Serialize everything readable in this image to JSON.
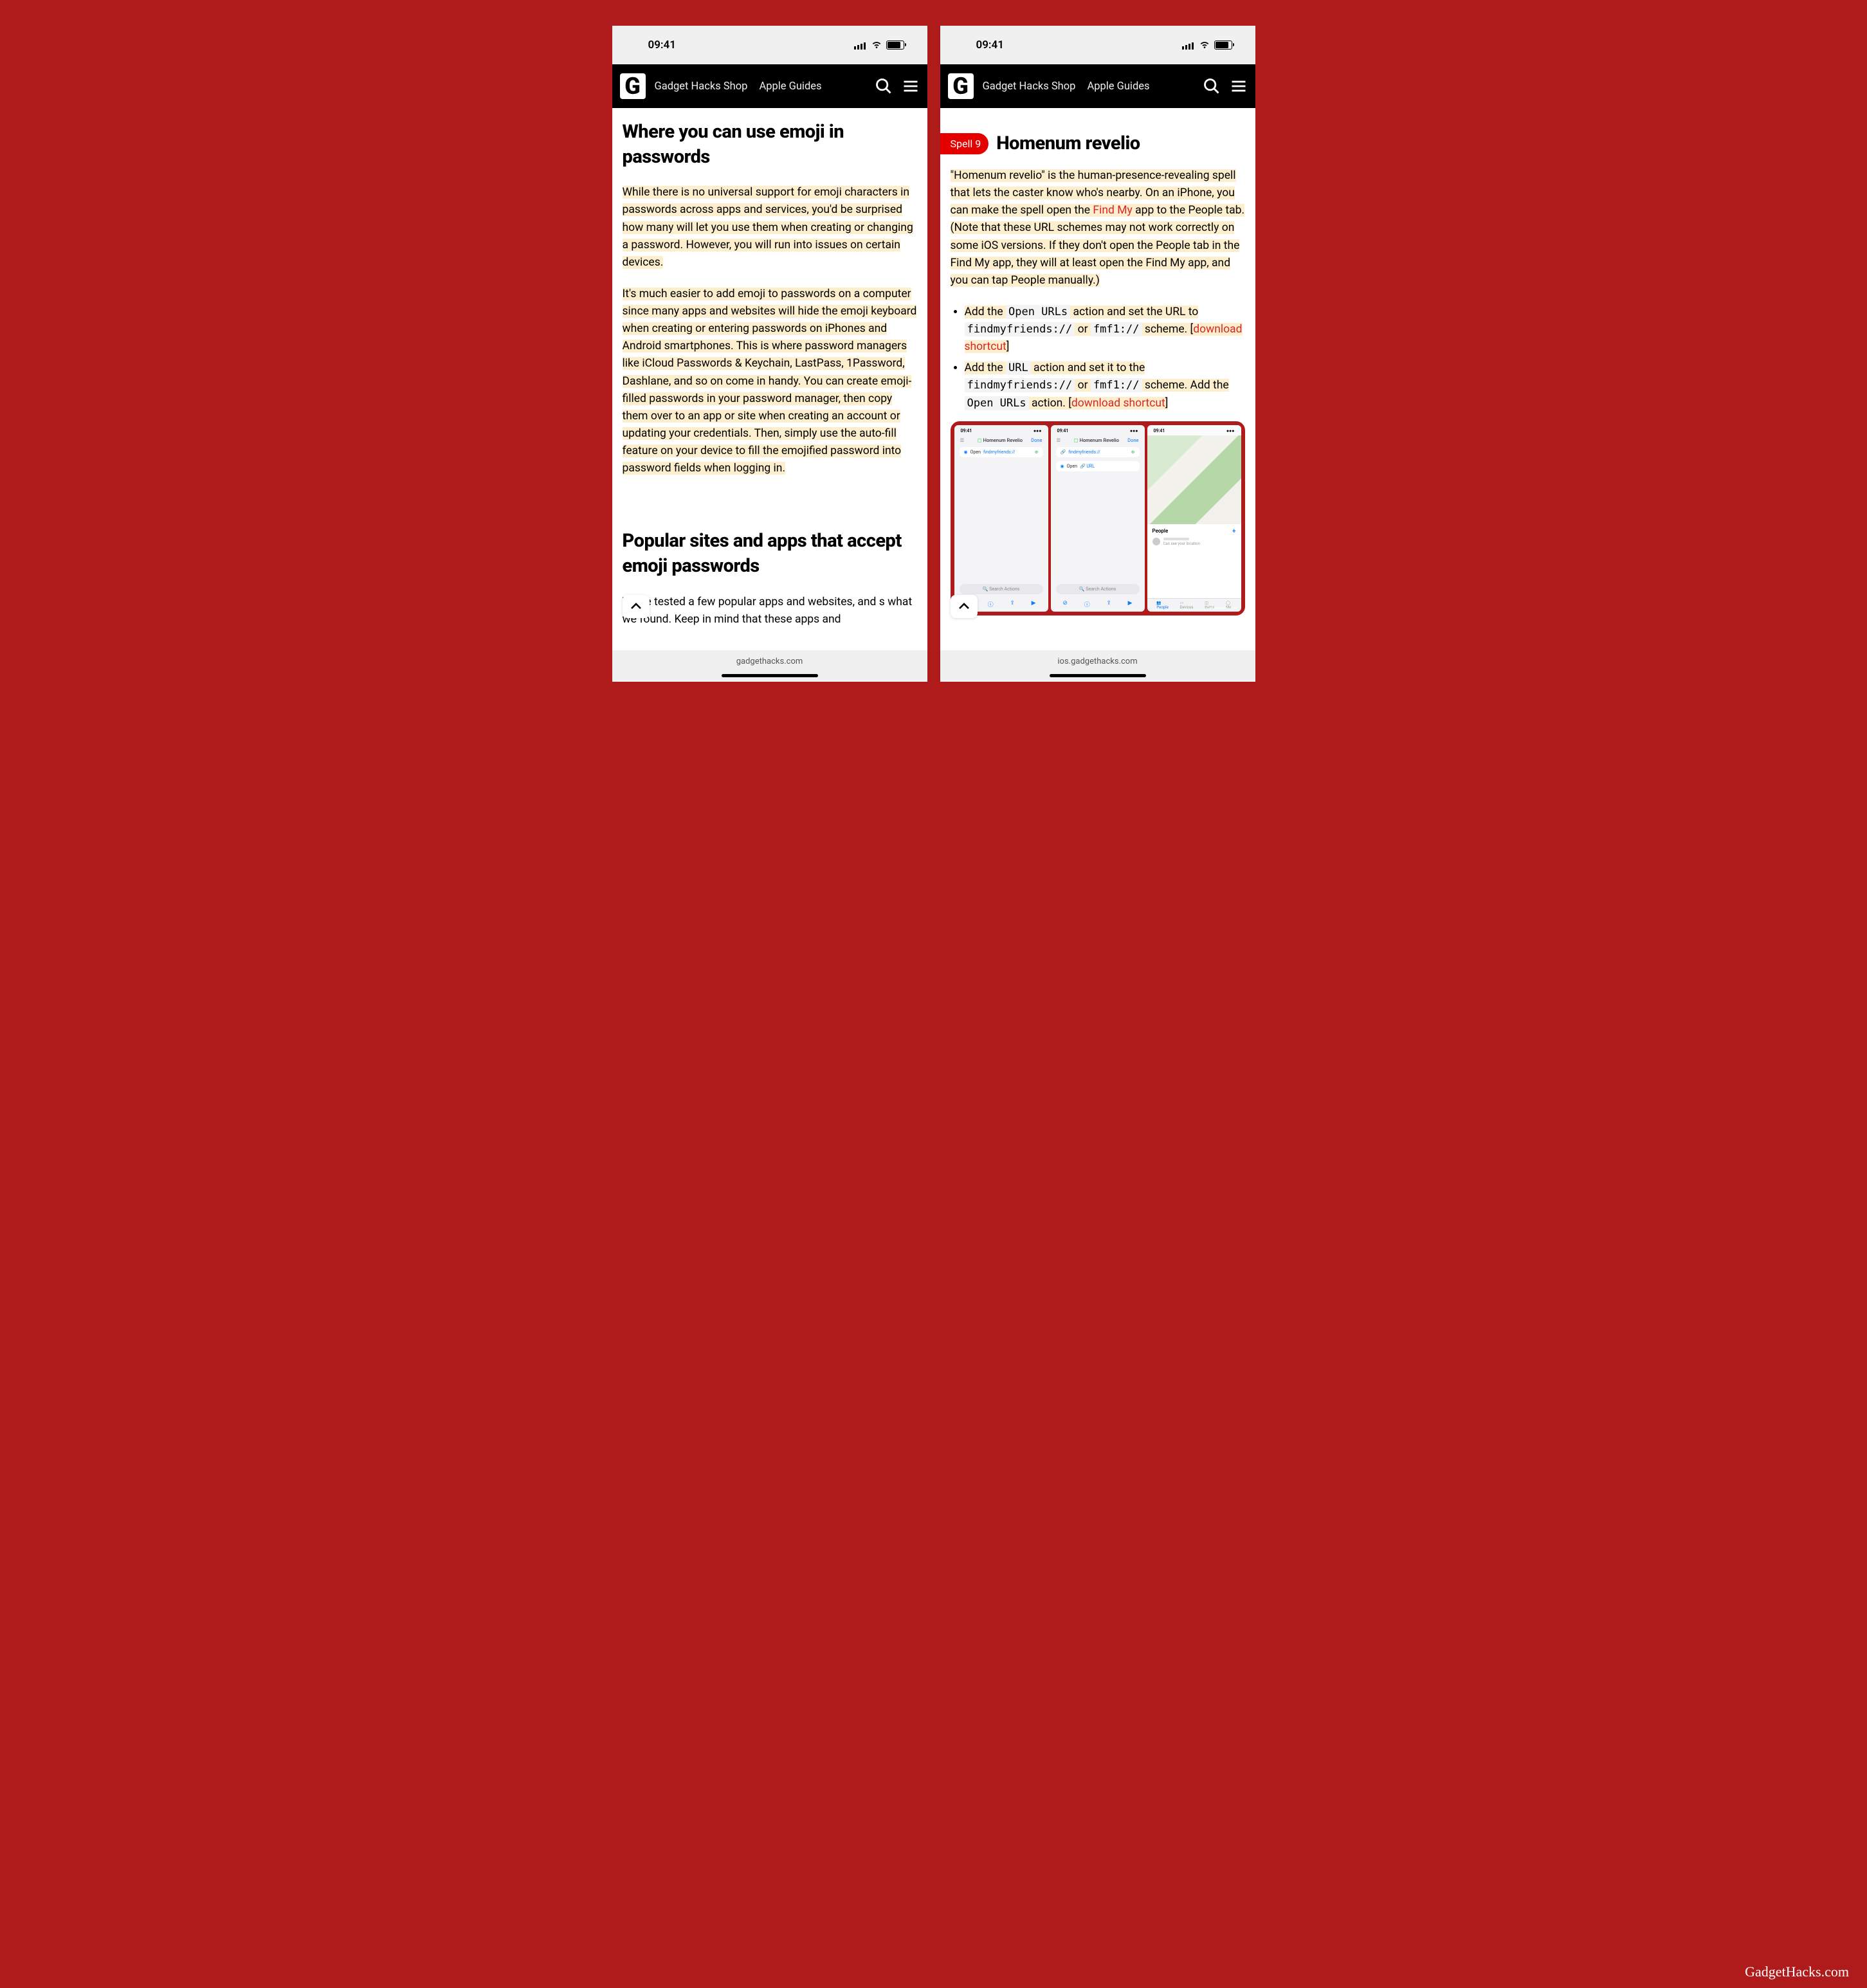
{
  "status": {
    "time": "09:41"
  },
  "header": {
    "nav": [
      "Gadget Hacks Shop",
      "Apple Guides"
    ]
  },
  "left": {
    "heading1": "Where you can use emoji in passwords",
    "para1": "While there is no universal support for emoji characters in passwords across apps and services, you'd be surprised how many will let you use them when creating or changing a password. However, you will run into issues on certain devices.",
    "para2": "It's much easier to add emoji to passwords on a computer since many apps and websites will hide the emoji keyboard when creating or entering passwords on iPhones and Android smartphones. This is where password managers like iCloud Passwords & Keychain, LastPass, 1Password, Dashlane, and so on come in handy. You can create emoji-filled passwords in your password manager, then copy them over to an app or site when creating an account or updating your credentials. Then, simply use the auto-fill feature on your device to fill the emojified password into password fields when logging in.",
    "heading2": "Popular sites and apps that accept emoji passwords",
    "para3_a": "We've tested a few popular apps and websites, and ",
    "para3_b": "s what we found. Keep in mind that these apps and",
    "domain": "gadgethacks.com"
  },
  "right": {
    "spell_label": "Spell 9",
    "spell_title": "Homenum revelio",
    "intro_a": "\"Homenum revelio\" is the human-presence-revealing spell that lets the caster know who's nearby. On an iPhone, you can make the spell open the ",
    "intro_link": "Find My",
    "intro_b": " app to the People tab. (Note that these URL schemes may not work correctly on some iOS versions. If they don't open the People tab in the Find My app, they will at least open the Find My app, and you can tap People manually.)",
    "b1": {
      "pre": "Add the ",
      "c1": "Open URLs",
      "mid1": " action and set the URL to ",
      "c2": "findmyfriends://",
      "or": " or ",
      "c3": "fmf1://",
      "post": " scheme. [",
      "dl": "download shortcut",
      "close": "]"
    },
    "b2": {
      "pre": "Add the ",
      "c1": "URL",
      "mid1": " action and set it to the ",
      "c2": "findmyfriends://",
      "or": " or ",
      "c3": "fmf1://",
      "mid2": " scheme. Add the ",
      "c4": "Open URLs",
      "post": " action. [",
      "dl": "download shortcut",
      "close": "]"
    },
    "shots": {
      "title": "Homenum Revelio",
      "done": "Done",
      "s1_action": {
        "label": "Open",
        "url": "findmyfriends://"
      },
      "s2_a1": "findmyfriends://",
      "s2_a2_label": "Open",
      "s2_a2_url": "URL",
      "search": "Search Actions",
      "people": "People",
      "person_sub": "Can see your location",
      "tabs": [
        "People",
        "Devices",
        "Items",
        "Me"
      ],
      "wm": "GadgetHacks.com"
    },
    "domain": "ios.gadgethacks.com"
  },
  "watermark": "GadgetHacks.com"
}
